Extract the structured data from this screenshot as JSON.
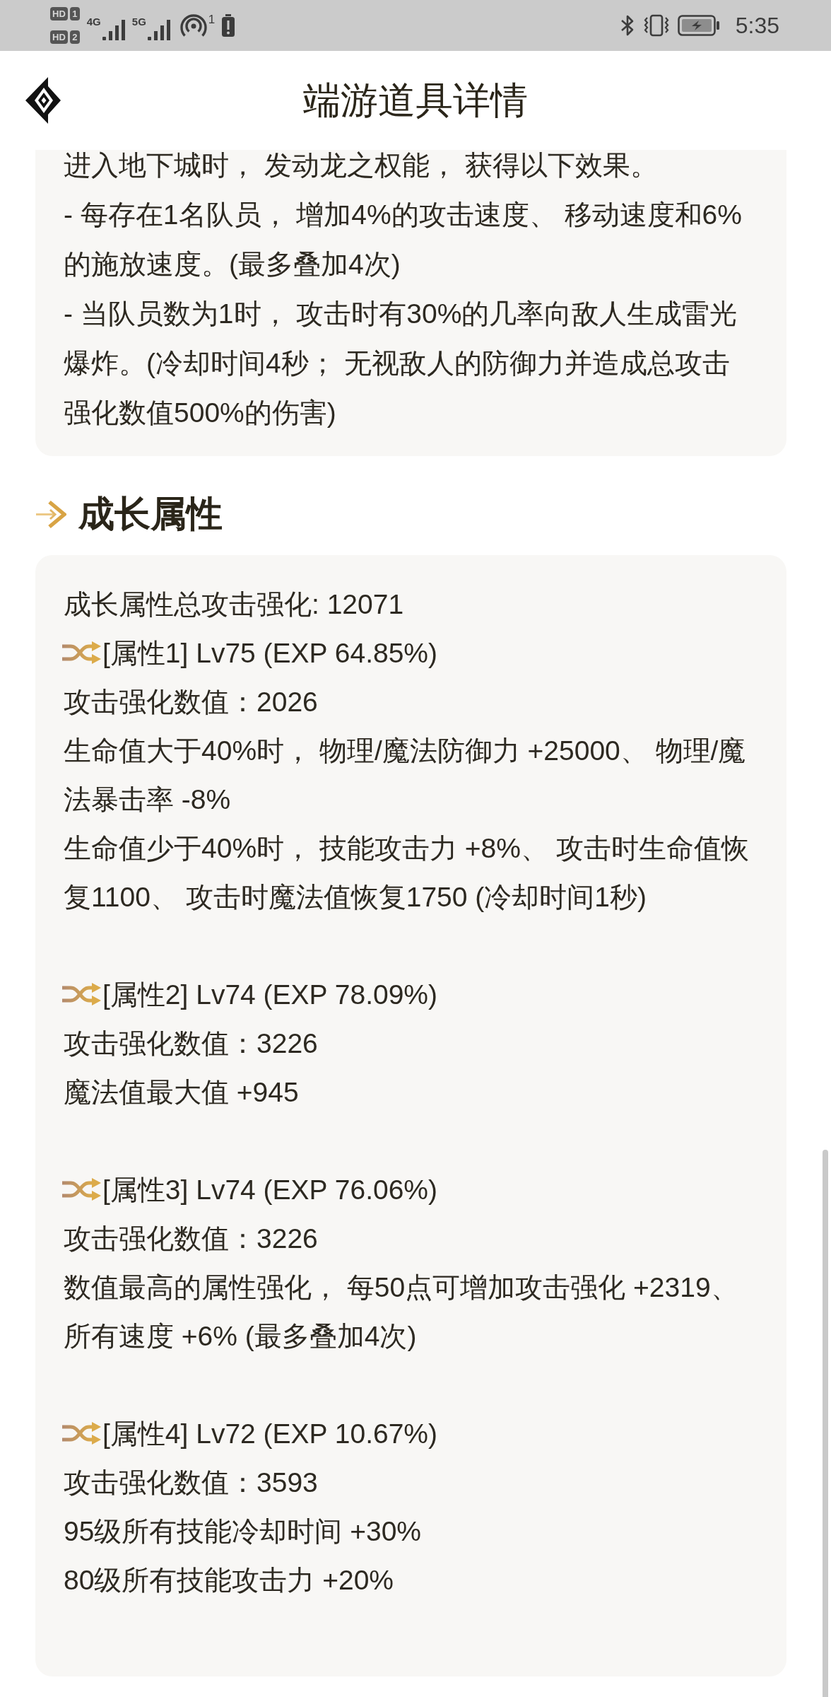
{
  "status_bar": {
    "sims": [
      {
        "label": "HD",
        "slot": "1"
      },
      {
        "label": "HD",
        "slot": "2"
      }
    ],
    "networks": [
      {
        "label": "4G"
      },
      {
        "label": "5G"
      }
    ],
    "hotspot": {
      "count": "1"
    },
    "time": "5:35"
  },
  "header": {
    "title": "端游道具详情"
  },
  "effect_card": {
    "paragraphs": [
      "进入地下城时， 发动龙之权能， 获得以下效果。",
      "- 每存在1名队员， 增加4%的攻击速度、 移动速度和6%的施放速度。(最多叠加4次)",
      "- 当队员数为1时， 攻击时有30%的几率向敌人生成雷光爆炸。(冷却时间4秒； 无视敌人的防御力并造成总攻击强化数值500%的伤害)"
    ]
  },
  "growth_section": {
    "title": "成长属性",
    "card": {
      "total": "成长属性总攻击强化: 12071",
      "attributes": [
        {
          "heading": "[属性1] Lv75 (EXP 64.85%)",
          "lines": [
            "攻击强化数值：2026",
            "生命值大于40%时， 物理/魔法防御力 +25000、 物理/魔法暴击率 -8%",
            "生命值少于40%时， 技能攻击力 +8%、 攻击时生命值恢复1100、 攻击时魔法值恢复1750 (冷却时间1秒)"
          ]
        },
        {
          "heading": "[属性2] Lv74 (EXP 78.09%)",
          "lines": [
            "攻击强化数值：3226",
            "魔法值最大值 +945"
          ]
        },
        {
          "heading": "[属性3] Lv74 (EXP 76.06%)",
          "lines": [
            "攻击强化数值：3226",
            "数值最高的属性强化， 每50点可增加攻击强化 +2319、所有速度 +6% (最多叠加4次)"
          ]
        },
        {
          "heading": "[属性4] Lv72 (EXP 10.67%)",
          "lines": [
            "攻击强化数值：3593",
            "95级所有技能冷却时间 +30%",
            "80级所有技能攻击力 +20%"
          ]
        }
      ]
    }
  }
}
